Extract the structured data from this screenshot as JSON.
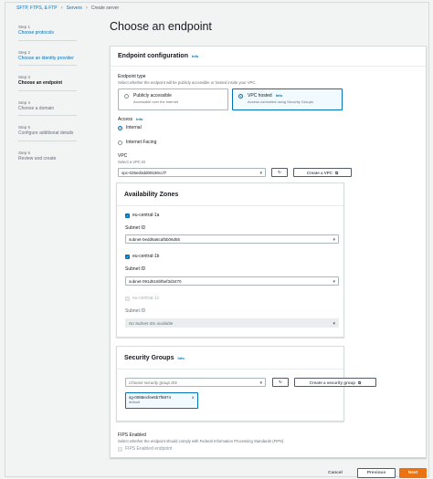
{
  "breadcrumb": {
    "item1": "SFTP, FTPS, & FTP",
    "item2": "Servers",
    "item3": "Create server"
  },
  "steps": [
    {
      "num": "Step 1",
      "label": "Choose protocols",
      "state": "link"
    },
    {
      "num": "Step 2",
      "label": "Choose an identity provider",
      "state": "link"
    },
    {
      "num": "Step 3",
      "label": "Choose an endpoint",
      "state": "active"
    },
    {
      "num": "Step 4",
      "label": "Choose a domain",
      "state": "disabled"
    },
    {
      "num": "Step 5",
      "label": "Configure additional details",
      "state": "disabled"
    },
    {
      "num": "Step 6",
      "label": "Review and create",
      "state": "disabled"
    }
  ],
  "page_title": "Choose an endpoint",
  "endpoint_config": {
    "title": "Endpoint configuration",
    "info": "Info",
    "type_label": "Endpoint type",
    "type_desc": "Select whether the endpoint will be publicly accessible or hosted inside your VPC.",
    "public_title": "Publicly accessible",
    "public_desc": "Accessible over the internet",
    "vpc_title": "VPC hosted",
    "vpc_info": "Info",
    "vpc_desc": "Access controlled using Security Groups",
    "access_label": "Access",
    "access_info": "Info",
    "internal": "Internal",
    "internet_facing": "Internet Facing",
    "vpc_label": "VPC",
    "vpc_desc2": "Select a VPC ID",
    "vpc_value": "vpc-025ed3dd09180ccf7",
    "create_vpc": "Create a VPC"
  },
  "availability_zones": {
    "title": "Availability Zones",
    "zones": [
      {
        "name": "eu-central-1a",
        "subnet_label": "Subnet ID",
        "subnet_value": "subnet-0edd6a8caf5b06d55",
        "checked": true
      },
      {
        "name": "eu-central-1b",
        "subnet_label": "Subnet ID",
        "subnet_value": "subnet-091d516bf5ef3d3470",
        "checked": true
      },
      {
        "name": "eu-central-1c",
        "subnet_label": "Subnet ID",
        "subnet_value": "No Subnet IDs available",
        "checked": false
      }
    ]
  },
  "security_groups": {
    "title": "Security Groups",
    "info": "Info",
    "placeholder": "Choose security group IDs",
    "create": "Create a security group",
    "token_id": "sg-0088ecfee5b7f6874",
    "token_desc": "default"
  },
  "fips": {
    "label": "FIPS Enabled",
    "desc": "Select whether the endpoint should comply with Federal Information Processing Standards (FIPS)",
    "checkbox": "FIPS Enabled endpoint"
  },
  "footer": {
    "cancel": "Cancel",
    "previous": "Previous",
    "next": "Next"
  },
  "colors": {
    "accent": "#0073bb",
    "primary_button": "#ec7211"
  }
}
